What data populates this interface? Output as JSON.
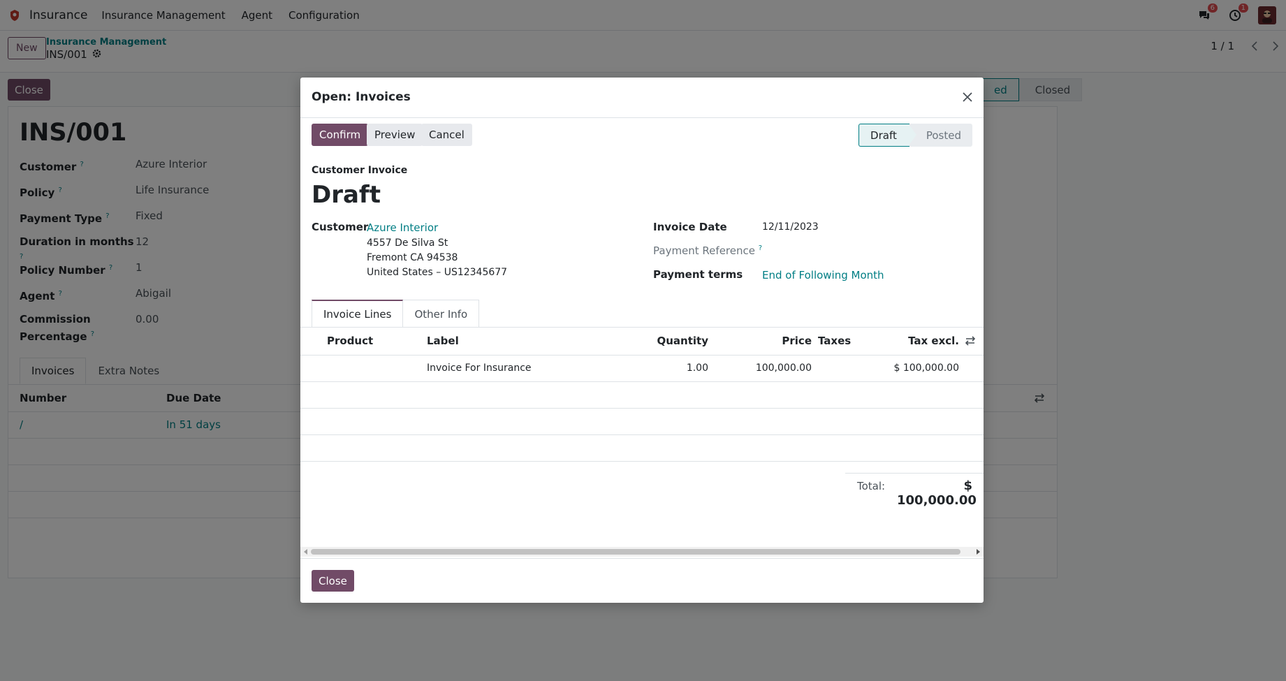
{
  "navbar": {
    "app_name": "Insurance",
    "menu": [
      "Insurance Management",
      "Agent",
      "Configuration"
    ],
    "messages_badge": "6",
    "activities_badge": "1"
  },
  "control": {
    "new_label": "New",
    "breadcrumb_parent": "Insurance Management",
    "breadcrumb_current": "INS/001",
    "pager": "1 / 1"
  },
  "form": {
    "close_label": "Close",
    "status_stages": [
      "ed",
      "Closed"
    ],
    "title": "INS/001",
    "fields": [
      {
        "label": "Customer",
        "value": "Azure Interior"
      },
      {
        "label": "Policy",
        "value": "Life Insurance"
      },
      {
        "label": "Payment Type",
        "value": "Fixed"
      },
      {
        "label": "Duration in months",
        "value": "12"
      },
      {
        "label": "Policy Number",
        "value": "1"
      },
      {
        "label": "Agent",
        "value": "Abigail"
      },
      {
        "label": "Commission",
        "label2": "Percentage",
        "value": "0.00"
      }
    ],
    "tabs": [
      "Invoices",
      "Extra Notes"
    ],
    "table_headers": [
      "Number",
      "Due Date"
    ],
    "rows": [
      {
        "number": "/",
        "due": "In 51 days"
      }
    ]
  },
  "modal": {
    "title": "Open: Invoices",
    "buttons": {
      "confirm": "Confirm",
      "preview": "Preview",
      "cancel": "Cancel"
    },
    "status": {
      "draft": "Draft",
      "posted": "Posted"
    },
    "doc_type": "Customer Invoice",
    "doc_state": "Draft",
    "customer_label": "Customer",
    "customer_name": "Azure Interior",
    "address": [
      "4557 De Silva St",
      "Fremont CA 94538",
      "United States – US12345677"
    ],
    "invoice_date_label": "Invoice Date",
    "invoice_date": "12/11/2023",
    "payment_ref_label": "Payment Reference",
    "payment_terms_label": "Payment terms",
    "payment_terms": "End of Following Month",
    "tabs": [
      "Invoice Lines",
      "Other Info"
    ],
    "columns": {
      "product": "Product",
      "label": "Label",
      "quantity": "Quantity",
      "price": "Price",
      "taxes": "Taxes",
      "tax_excl": "Tax excl."
    },
    "lines": [
      {
        "product": "",
        "label": "Invoice For Insurance",
        "quantity": "1.00",
        "price": "100,000.00",
        "taxes": "",
        "tax_excl": "$ 100,000.00"
      }
    ],
    "total_label": "Total:",
    "total_value": "$ 100,000.00",
    "footer_close": "Close"
  },
  "colors": {
    "primary": "#714b67",
    "link": "#017e84",
    "badge": "#e04a4f"
  }
}
